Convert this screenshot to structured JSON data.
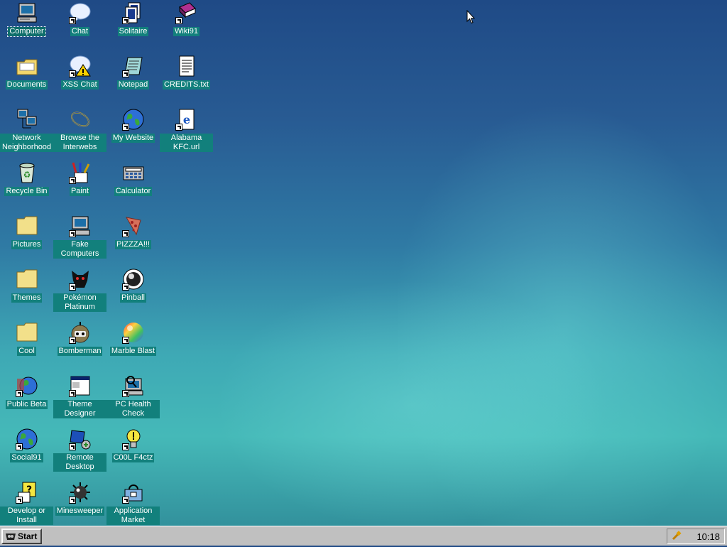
{
  "desktop": {
    "icons": [
      {
        "label": "Computer",
        "icon": "computer-icon"
      },
      {
        "label": "Chat",
        "icon": "chat-icon"
      },
      {
        "label": "Solitaire",
        "icon": "solitaire-icon"
      },
      {
        "label": "Wiki91",
        "icon": "book-icon"
      },
      {
        "label": "Documents",
        "icon": "folder-icon"
      },
      {
        "label": "XSS Chat",
        "icon": "warning-chat-icon"
      },
      {
        "label": "Notepad",
        "icon": "notepad-icon"
      },
      {
        "label": "CREDITS.txt",
        "icon": "text-file-icon"
      },
      {
        "label": "Network Neighborhood",
        "icon": "network-icon"
      },
      {
        "label": "Browse the Interwebs",
        "icon": "browser-icon"
      },
      {
        "label": "My Website",
        "icon": "globe-icon"
      },
      {
        "label": "Alabama KFC.url",
        "icon": "url-file-icon"
      },
      {
        "label": "Recycle Bin",
        "icon": "recycle-bin-icon"
      },
      {
        "label": "Paint",
        "icon": "paint-icon"
      },
      {
        "label": "Calculator",
        "icon": "calculator-icon"
      },
      {
        "label": "Pictures",
        "icon": "folder-icon"
      },
      {
        "label": "Fake Computers",
        "icon": "computer-icon"
      },
      {
        "label": "PIZZZA!!!",
        "icon": "pizza-icon"
      },
      {
        "label": "Themes",
        "icon": "folder-icon"
      },
      {
        "label": "Pokémon Platinum",
        "icon": "pokemon-icon"
      },
      {
        "label": "Pinball",
        "icon": "pinball-icon"
      },
      {
        "label": "Cool",
        "icon": "folder-icon"
      },
      {
        "label": "Bomberman",
        "icon": "bomberman-icon"
      },
      {
        "label": "Marble Blast",
        "icon": "marble-icon"
      },
      {
        "label": "Public Beta",
        "icon": "globe-icon"
      },
      {
        "label": "Theme Designer",
        "icon": "window-icon"
      },
      {
        "label": "PC Health Check",
        "icon": "health-check-icon"
      },
      {
        "label": "Social91",
        "icon": "globe-icon"
      },
      {
        "label": "Remote Desktop",
        "icon": "remote-desktop-icon"
      },
      {
        "label": "C00L F4ctz",
        "icon": "lightbulb-icon"
      },
      {
        "label": "Develop or Install",
        "icon": "develop-icon"
      },
      {
        "label": "Minesweeper",
        "icon": "mine-icon"
      },
      {
        "label": "Application Market",
        "icon": "market-icon"
      }
    ]
  },
  "taskbar": {
    "start_label": "Start",
    "clock": "10:18"
  },
  "colors": {
    "label_bg": "#12807c",
    "taskbar": "#c0c0c0"
  }
}
